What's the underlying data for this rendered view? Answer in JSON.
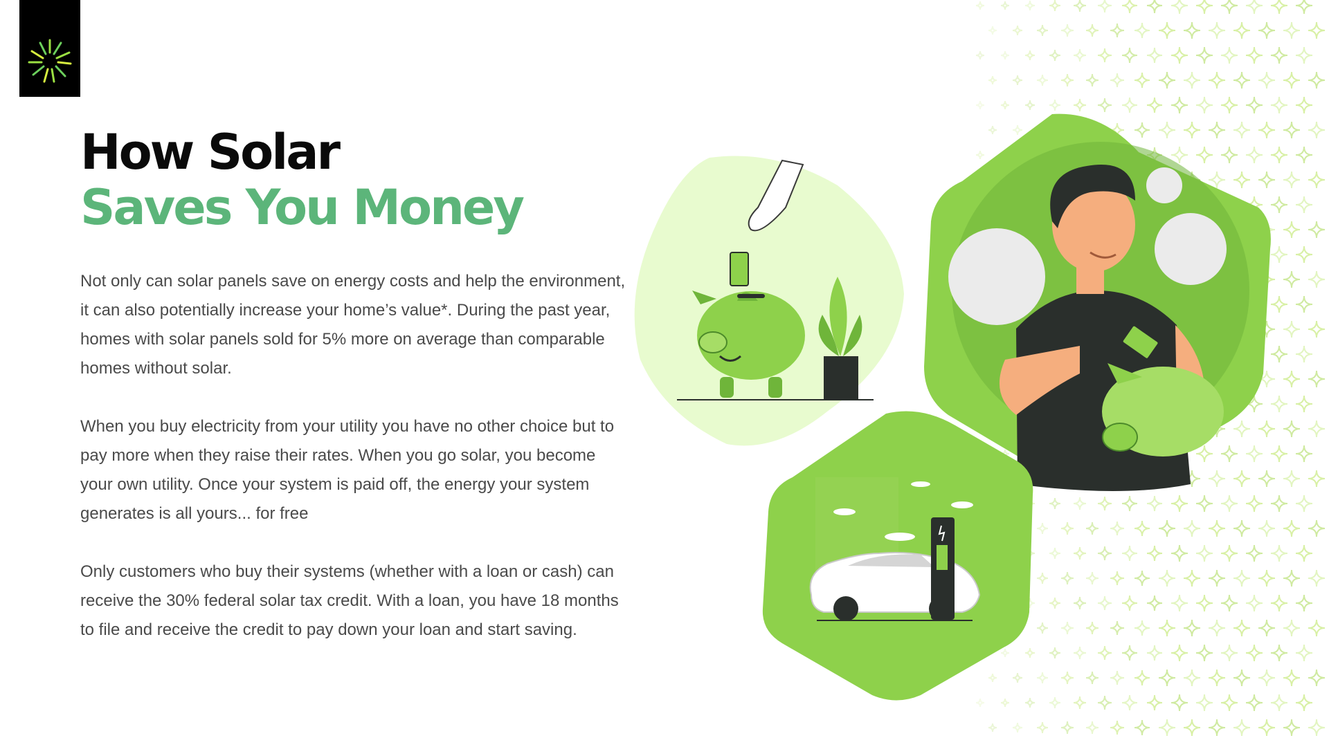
{
  "title": {
    "line1": "How Solar",
    "line2": "Saves You Money"
  },
  "paragraphs": [
    "Not only can solar panels save on energy costs and help the environment, it can also potentially increase your home’s value*. During the past year, homes with solar panels sold for 5% more on average than comparable homes without solar.",
    "When you buy electricity from your utility you have no other choice but to pay more when they raise their rates. When you go solar, you become your own utility. Once your system is paid off, the energy your system generates is all yours... for free",
    "Only customers who buy their systems (whether with a loan or cash) can receive the 30% federal solar tax credit. With a loan, you have 18 months to file and receive the credit to pay down your loan and start saving."
  ],
  "illustrations": [
    {
      "name": "hand-coin-piggy-bank",
      "icon": "piggy-bank-icon"
    },
    {
      "name": "man-saving-money",
      "icon": "man-with-piggy-bank-icon"
    },
    {
      "name": "electric-car-charging",
      "icon": "ev-charging-icon"
    }
  ],
  "colors": {
    "brand_green": "#5cb57a",
    "accent_green": "#8ed14b",
    "light_green": "#e8fbcf",
    "logo_background": "#000000",
    "body_text": "#4a4a4a"
  }
}
